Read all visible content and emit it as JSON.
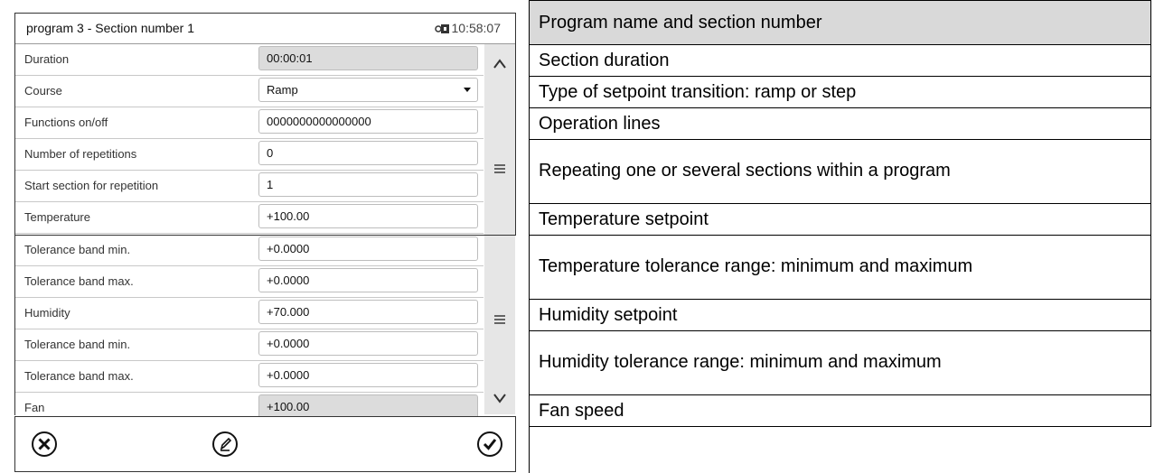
{
  "screen": {
    "title": "program 3 - Section number 1",
    "clock": "10:58:07",
    "rows": [
      {
        "label": "Duration",
        "value": "00:00:01"
      },
      {
        "label": "Course",
        "value": "Ramp"
      },
      {
        "label": "Functions on/off",
        "value": "0000000000000000"
      },
      {
        "label": "Number of repetitions",
        "value": "0"
      },
      {
        "label": "Start section for repetition",
        "value": "1"
      },
      {
        "label": "Temperature",
        "value": "+100.00"
      },
      {
        "label": "Tolerance band min.",
        "value": "+0.0000"
      },
      {
        "label": "Tolerance band max.",
        "value": "+0.0000"
      },
      {
        "label": "Humidity",
        "value": "+70.000"
      },
      {
        "label": "Tolerance band min.",
        "value": "+0.0000"
      },
      {
        "label": "Tolerance band max.",
        "value": "+0.0000"
      },
      {
        "label": "Fan",
        "value": "+100.00"
      }
    ],
    "icons": {
      "lock": "lock-icon",
      "scroll_up": "chevron-up-icon",
      "scroll_handle": "menu-lines-icon",
      "scroll_down": "chevron-down-icon",
      "cancel": "close-circle-icon",
      "edit": "pencil-circle-icon",
      "confirm": "check-circle-icon"
    }
  },
  "descriptions": [
    "Program name and section number",
    "Section duration",
    "Type of setpoint transition: ramp or step",
    "Operation lines",
    "Repeating one or several sections within a program",
    "Temperature setpoint",
    "Temperature tolerance range: minimum and maximum",
    "Humidity setpoint",
    "Humidity tolerance range: minimum and maximum",
    "Fan speed"
  ],
  "colors": {
    "header_bg": "#d9d9d9",
    "readonly_field_bg": "#dcdcdc",
    "scrollbar_bg": "#e6e6e6"
  }
}
